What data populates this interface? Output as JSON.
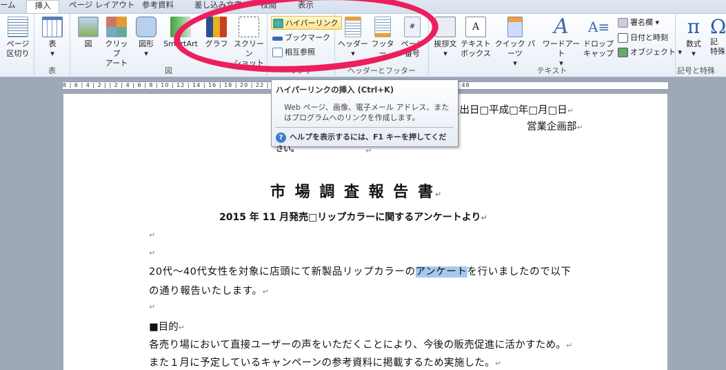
{
  "tabs": [
    "ーム",
    "挿入",
    "ページ レイアウト",
    "参考資料",
    "差し込み文書",
    "校閲",
    "表示"
  ],
  "active_tab": "挿入",
  "groups": {
    "page": {
      "break": "ページ\n区切り"
    },
    "table": {
      "label": "表",
      "btn": "表"
    },
    "illust": {
      "label": "図",
      "picture": "図",
      "clipart": "クリップ\nアート",
      "shapes": "図形",
      "smartart": "SmartArt",
      "chart": "グラフ",
      "screenshot": "スクリーン\nショット"
    },
    "links": {
      "label": "リンク",
      "hyperlink": "ハイパーリンク",
      "bookmark": "ブックマーク",
      "crossref": "相互参照"
    },
    "hf": {
      "label": "ヘッダーとフッター",
      "header": "ヘッダー",
      "footer": "フッター",
      "pagenum": "ページ\n番号"
    },
    "text": {
      "label": "テキスト",
      "greeting": "挨拶文",
      "textbox": "テキスト\nボックス",
      "quickparts": "クイック パーツ",
      "wordart": "ワードアート",
      "dropcap": "ドロップ\nキャップ",
      "signature": "署名欄",
      "datetime": "日付と時刻",
      "object": "オブジェクト"
    },
    "symbols": {
      "label": "記号と特殊",
      "equation": "数式",
      "special": "記\n特殊"
    }
  },
  "ruler": "8 | 6 | 4 | 2 | | 2 | 4 | 6 | 8 | 10 | 12 | 14 | 16 | 18 | 20 | 22 | 24 | 26 | 28 | 30 | 32 | 34 | 36 | 38 | 40 | 42 | 44 | 46 | 48",
  "tooltip": {
    "title": "ハイパーリンクの挿入 (Ctrl+K)",
    "desc": "Web ページ、画像、電子メール アドレス、またはプログラムへのリンクを作成します。",
    "help": "ヘルプを表示するには、F1 キーを押してください。"
  },
  "doc": {
    "date": "提出日□平成□年□月□日",
    "dept": "営業企画部",
    "title": "市 場 調 査 報 告 書",
    "subtitle": "2015 年 11 月発売□リップカラーに関するアンケートより",
    "p1a": "20代～40代女性を対象に店頭にて新製品リップカラーの",
    "p1sel": "アンケート",
    "p1b": "を行いましたので以下",
    "p2": "の通り報告いたします。",
    "h1": "■目的",
    "p3": "各売り場において直接ユーザーの声をいただくことにより、今後の販売促進に活かすため。",
    "p4": "また１月に予定しているキャンペーンの参考資料に掲載するため実施した。",
    "para_mark": "↵"
  },
  "colors": {
    "highlight_ellipse": "#ec1f5c",
    "selection": "#a8c8ef"
  }
}
